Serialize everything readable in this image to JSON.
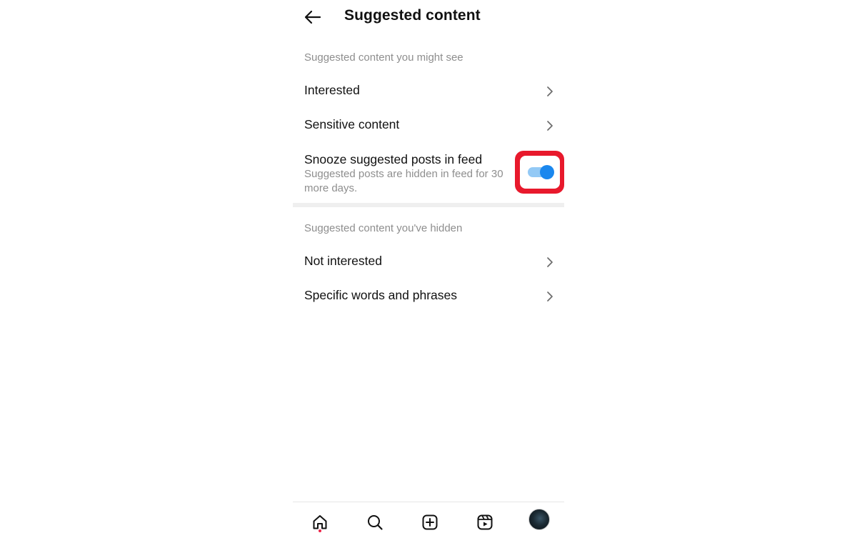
{
  "header": {
    "title": "Suggested content",
    "back_icon": "arrow-left-icon"
  },
  "sections": {
    "might_see": {
      "heading": "Suggested content you might see",
      "items": [
        {
          "label": "Interested"
        },
        {
          "label": "Sensitive content"
        }
      ],
      "snooze": {
        "title": "Snooze suggested posts in feed",
        "subtitle": "Suggested posts are hidden in feed for 30 more days.",
        "toggle_on": true
      }
    },
    "hidden": {
      "heading": "Suggested content you've hidden",
      "items": [
        {
          "label": "Not interested"
        },
        {
          "label": "Specific words and phrases"
        }
      ]
    }
  },
  "bottom_nav": [
    {
      "icon": "home-icon",
      "active": true
    },
    {
      "icon": "search-icon"
    },
    {
      "icon": "create-post-icon"
    },
    {
      "icon": "reels-icon"
    },
    {
      "icon": "profile-avatar"
    }
  ],
  "colors": {
    "toggle_accent": "#1a87ee",
    "toggle_track": "#93c9f5",
    "highlight_annotation": "#e8192c",
    "muted_text": "#8e8e8e",
    "notification_dot": "#ed2549"
  }
}
